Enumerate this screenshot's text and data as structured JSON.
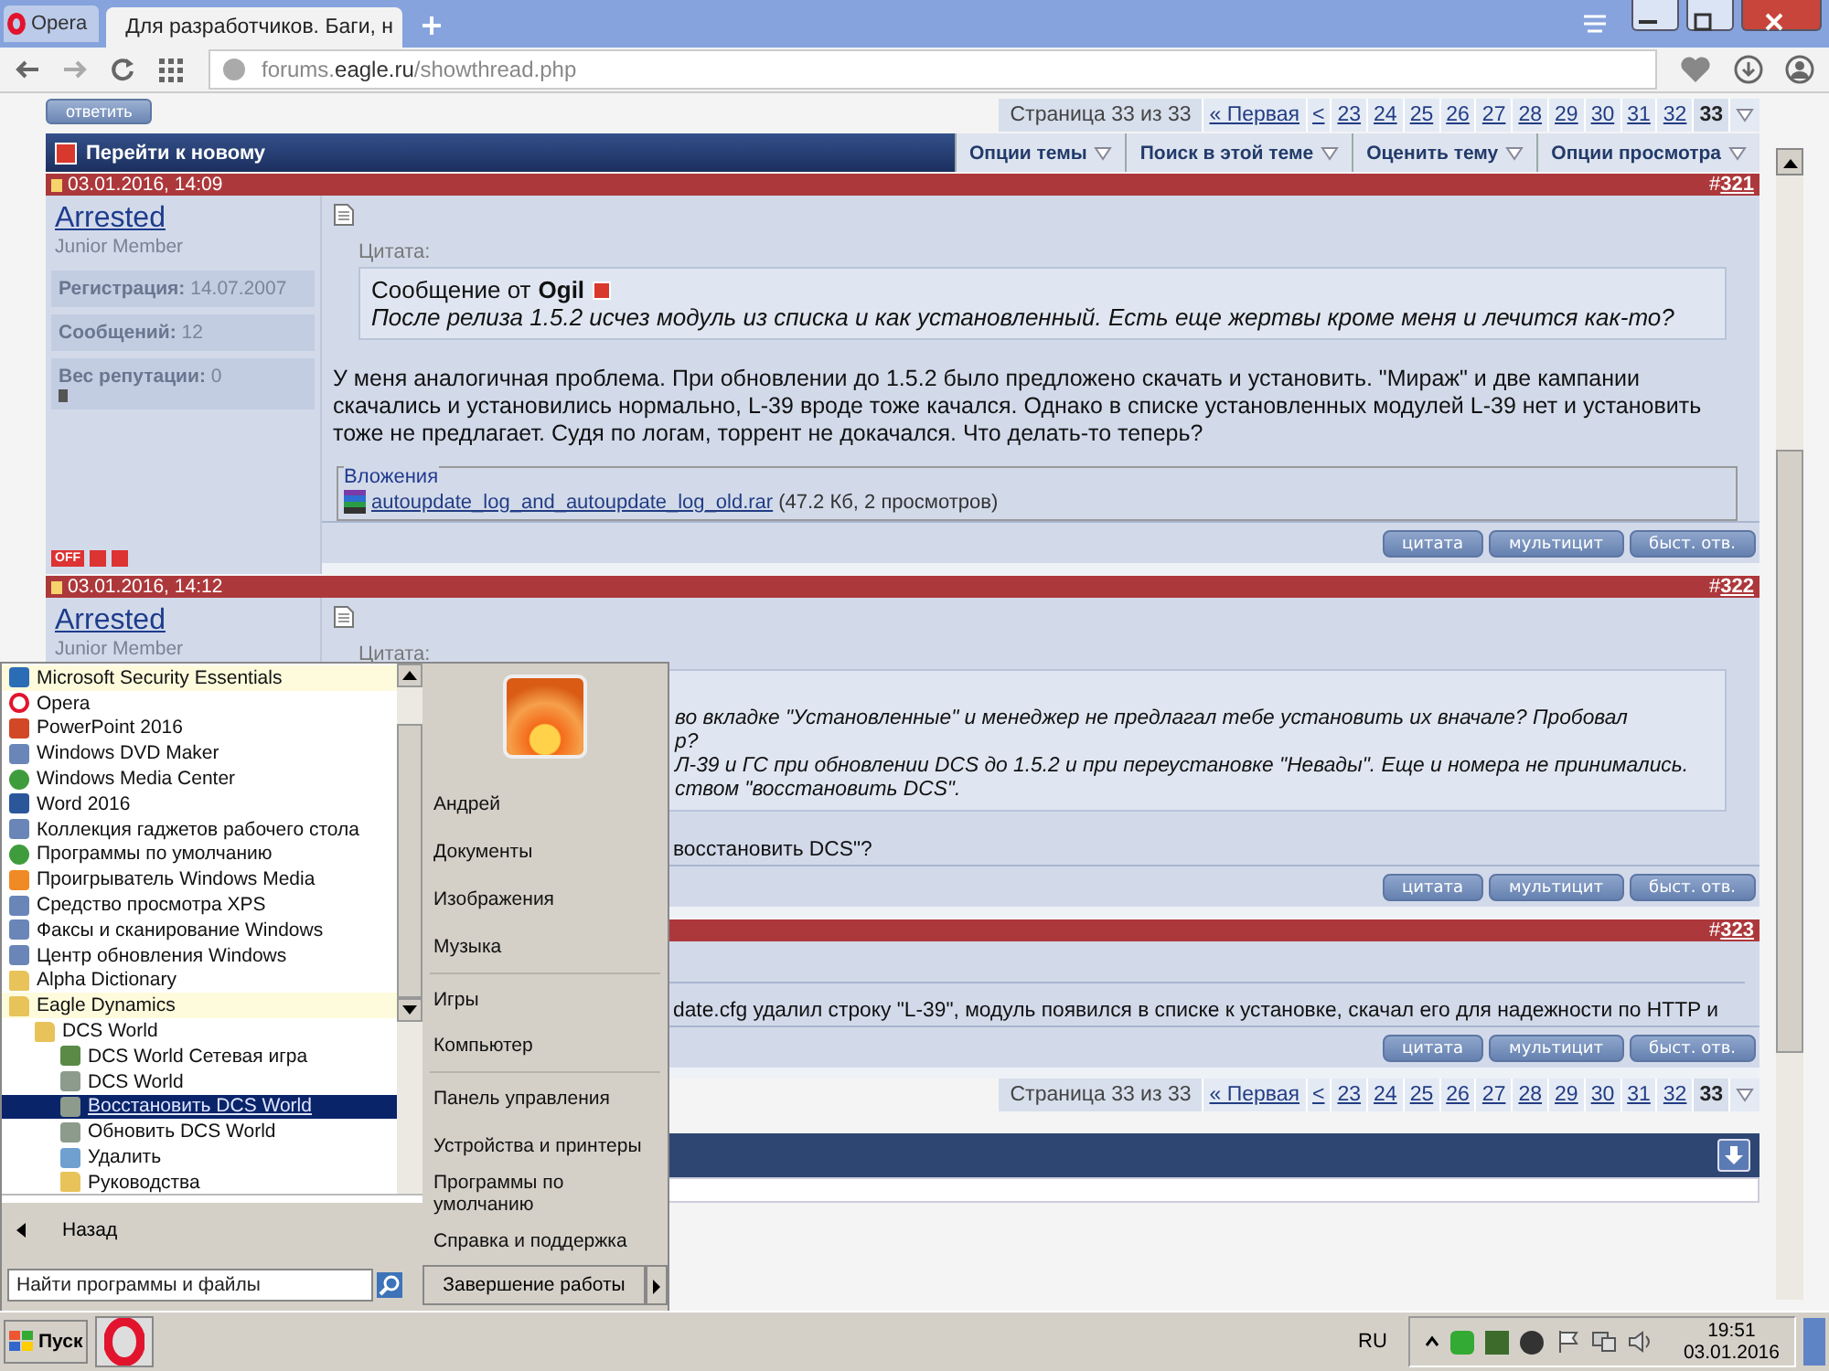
{
  "browser": {
    "tabs": [
      {
        "label": "Opera",
        "kind": "menu",
        "selected": false
      },
      {
        "label": "Для разработчиков. Баги, н",
        "kind": "page",
        "selected": true
      }
    ],
    "address": {
      "prefix": "forums.",
      "domain": "eagle.ru",
      "path": "/showthread.php"
    }
  },
  "forum": {
    "reply_button": "ответить",
    "pagination_top": {
      "label": "Страница 33 из 33",
      "pages": [
        {
          "label": "« Первая",
          "selected": false
        },
        {
          "label": "<",
          "selected": false
        },
        {
          "label": "23",
          "selected": false
        },
        {
          "label": "24",
          "selected": false
        },
        {
          "label": "25",
          "selected": false
        },
        {
          "label": "26",
          "selected": false
        },
        {
          "label": "27",
          "selected": false
        },
        {
          "label": "28",
          "selected": false
        },
        {
          "label": "29",
          "selected": false
        },
        {
          "label": "30",
          "selected": false
        },
        {
          "label": "31",
          "selected": false
        },
        {
          "label": "32",
          "selected": false
        },
        {
          "label": "33",
          "selected": true
        }
      ]
    },
    "navbar": {
      "title": "Перейти к новому",
      "menus": [
        "Опции темы",
        "Поиск в этой теме",
        "Оценить тему",
        "Опции просмотра"
      ]
    },
    "posts": [
      {
        "date": "03.01.2016, 14:09",
        "hash": "#",
        "number": "321",
        "user": {
          "name": "Arrested",
          "title": "Junior Member",
          "info": [
            {
              "label": "Регистрация:",
              "value": "14.07.2007"
            },
            {
              "label": "Сообщений:",
              "value": "12"
            },
            {
              "label": "Вес репутации:",
              "value": "0"
            }
          ],
          "status": "OFF"
        },
        "quote": {
          "label": "Цитата:",
          "author_prefix": "Сообщение от",
          "author": "Ogil",
          "lines": [
            "После релиза 1.5.2 исчез модуль из списка и как установленный. Есть еще жертвы кроме меня и лечится как-то?"
          ]
        },
        "body": [
          "У меня аналогичная проблема. При обновлении до 1.5.2 было предложено скачать и установить. \"Мираж\" и две кампании скачались и установились нормально, L-39 вроде тоже качался. Однако в списке установленных модулей L-39 нет и установить тоже не предлагает. Судя по логам, торрент не докачался. Что делать-то теперь?"
        ],
        "attachments": {
          "legend": "Вложения",
          "file": "autoupdate_log_and_autoupdate_log_old.rar",
          "meta": "(47.2 Кб, 2 просмотров)"
        },
        "buttons": [
          "цитата",
          "мультицит",
          "быст. отв."
        ]
      },
      {
        "date": "03.01.2016, 14:12",
        "hash": "#",
        "number": "322",
        "user": {
          "name": "Arrested",
          "title": "Junior Member"
        },
        "quote": {
          "label": "Цитата:",
          "lines": [
            "во вкладке \"Установленные\" и менеджер не предлагал тебе установить их вначале? Пробовал",
            "р?",
            "Л-39 и ГС при обновлении DCS до 1.5.2 и при переустановке \"Невады\". Еще и номера не принимались.",
            "ством \"восстановить DCS\"."
          ]
        },
        "body": [
          "восстановить DCS\"?"
        ],
        "buttons": [
          "цитата",
          "мультицит",
          "быст. отв."
        ]
      },
      {
        "hash": "#",
        "number": "323",
        "body": [
          "date.cfg удалил строку \"L-39\", модуль появился в списке к установке, скачал его для надежности по HTTP и"
        ],
        "buttons": [
          "цитата",
          "мультицит",
          "быст. отв."
        ]
      }
    ],
    "pagination_bottom": {
      "label": "Страница 33 из 33",
      "pages": [
        {
          "label": "« Первая",
          "selected": false
        },
        {
          "label": "<",
          "selected": false
        },
        {
          "label": "23",
          "selected": false
        },
        {
          "label": "24",
          "selected": false
        },
        {
          "label": "25",
          "selected": false
        },
        {
          "label": "26",
          "selected": false
        },
        {
          "label": "27",
          "selected": false
        },
        {
          "label": "28",
          "selected": false
        },
        {
          "label": "29",
          "selected": false
        },
        {
          "label": "30",
          "selected": false
        },
        {
          "label": "31",
          "selected": false
        },
        {
          "label": "32",
          "selected": false
        },
        {
          "label": "33",
          "selected": true
        }
      ]
    }
  },
  "start_menu": {
    "programs": [
      {
        "label": "Microsoft Security Essentials",
        "kind": "shield",
        "highlighted": true,
        "selected": false
      },
      {
        "label": "Opera",
        "kind": "opera",
        "highlighted": false,
        "selected": false
      },
      {
        "label": "PowerPoint 2016",
        "kind": "powerpoint",
        "highlighted": false,
        "selected": false
      },
      {
        "label": "Windows DVD Maker",
        "kind": "dvd",
        "highlighted": false,
        "selected": false
      },
      {
        "label": "Windows Media Center",
        "kind": "mediacenter",
        "highlighted": false,
        "selected": false
      },
      {
        "label": "Word 2016",
        "kind": "word",
        "highlighted": false,
        "selected": false
      },
      {
        "label": "Коллекция гаджетов рабочего стола",
        "kind": "gadgets",
        "highlighted": false,
        "selected": false
      },
      {
        "label": "Программы по умолчанию",
        "kind": "defaults",
        "highlighted": false,
        "selected": false
      },
      {
        "label": "Проигрыватель Windows Media",
        "kind": "mediaplayer",
        "highlighted": false,
        "selected": false
      },
      {
        "label": "Средство просмотра XPS",
        "kind": "xps",
        "highlighted": false,
        "selected": false
      },
      {
        "label": "Факсы и сканирование Windows",
        "kind": "fax",
        "highlighted": false,
        "selected": false
      },
      {
        "label": "Центр обновления Windows",
        "kind": "update",
        "highlighted": false,
        "selected": false
      },
      {
        "label": "Alpha Dictionary",
        "kind": "folder",
        "highlighted": false,
        "selected": false
      },
      {
        "label": "Eagle Dynamics",
        "kind": "folder",
        "highlighted": true,
        "selected": false,
        "children": [
          {
            "label": "DCS World",
            "kind": "folder",
            "highlighted": false,
            "selected": false,
            "children": [
              {
                "label": "DCS World Сетевая игра",
                "kind": "dcsnet",
                "highlighted": false,
                "selected": false
              },
              {
                "label": "DCS World",
                "kind": "dcs",
                "highlighted": false,
                "selected": false
              },
              {
                "label": "Восстановить DCS World",
                "kind": "dcs",
                "highlighted": false,
                "selected": true
              },
              {
                "label": "Обновить DCS World",
                "kind": "dcs",
                "highlighted": false,
                "selected": false
              },
              {
                "label": "Удалить",
                "kind": "uninstall",
                "highlighted": false,
                "selected": false
              },
              {
                "label": "Руководства",
                "kind": "folder",
                "highlighted": false,
                "selected": false
              }
            ]
          }
        ]
      }
    ],
    "back": "Назад",
    "search": {
      "placeholder": "Найти программы и файлы"
    },
    "places": [
      [
        "Андрей",
        "Документы",
        "Изображения",
        "Музыка"
      ],
      [
        "Игры",
        "Компьютер"
      ],
      [
        "Панель управления",
        "Устройства и принтеры",
        "Программы по умолчанию",
        "Справка и поддержка"
      ]
    ],
    "shutdown": "Завершение работы"
  },
  "taskbar": {
    "start": "Пуск",
    "language": "RU",
    "time": "19:51",
    "date": "03.01.2016"
  }
}
